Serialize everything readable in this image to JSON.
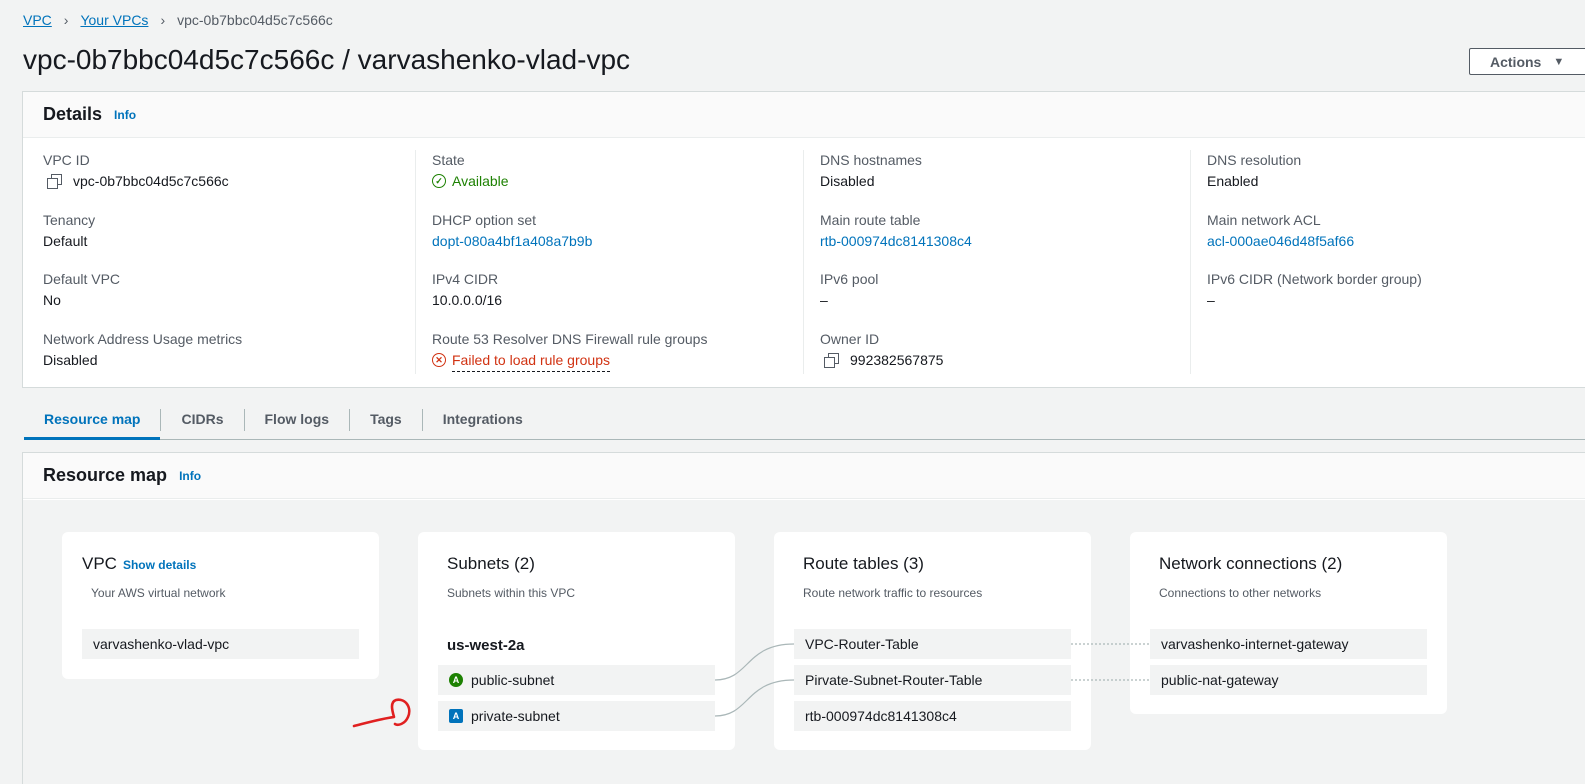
{
  "breadcrumb": {
    "root": "VPC",
    "parent": "Your VPCs",
    "current": "vpc-0b7bbc04d5c7c566c"
  },
  "page": {
    "title": "vpc-0b7bbc04d5c7c566c / varvashenko-vlad-vpc",
    "actions_label": "Actions"
  },
  "details": {
    "title": "Details",
    "info": "Info",
    "col1": [
      {
        "label": "VPC ID",
        "value": "vpc-0b7bbc04d5c7c566c"
      },
      {
        "label": "Tenancy",
        "value": "Default"
      },
      {
        "label": "Default VPC",
        "value": "No"
      },
      {
        "label": "Network Address Usage metrics",
        "value": "Disabled"
      }
    ],
    "col2": [
      {
        "label": "State",
        "value": "Available"
      },
      {
        "label": "DHCP option set",
        "value": "dopt-080a4bf1a408a7b9b"
      },
      {
        "label": "IPv4 CIDR",
        "value": "10.0.0.0/16"
      },
      {
        "label": "Route 53 Resolver DNS Firewall rule groups",
        "value": "Failed to load rule groups"
      }
    ],
    "col3": [
      {
        "label": "DNS hostnames",
        "value": "Disabled"
      },
      {
        "label": "Main route table",
        "value": "rtb-000974dc8141308c4"
      },
      {
        "label": "IPv6 pool",
        "value": "–"
      },
      {
        "label": "Owner ID",
        "value": "992382567875"
      }
    ],
    "col4": [
      {
        "label": "DNS resolution",
        "value": "Enabled"
      },
      {
        "label": "Main network ACL",
        "value": "acl-000ae046d48f5af66"
      },
      {
        "label": "IPv6 CIDR (Network border group)",
        "value": "–"
      }
    ]
  },
  "tabs": [
    "Resource map",
    "CIDRs",
    "Flow logs",
    "Tags",
    "Integrations"
  ],
  "resource_map": {
    "title": "Resource map",
    "info": "Info",
    "vpc_card": {
      "title": "VPC",
      "show_details": "Show details",
      "subtitle": "Your AWS virtual network",
      "item": "varvashenko-vlad-vpc"
    },
    "subnets_card": {
      "title": "Subnets (2)",
      "subtitle": "Subnets within this VPC",
      "az": "us-west-2a",
      "public_letter": "A",
      "private_letter": "A",
      "items": [
        "public-subnet",
        "private-subnet"
      ]
    },
    "routes_card": {
      "title": "Route tables (3)",
      "subtitle": "Route network traffic to resources",
      "items": [
        "VPC-Router-Table",
        "Pirvate-Subnet-Router-Table",
        "rtb-000974dc8141308c4"
      ]
    },
    "network_card": {
      "title": "Network connections (2)",
      "subtitle": "Connections to other networks",
      "items": [
        "varvashenko-internet-gateway",
        "public-nat-gateway"
      ]
    }
  },
  "colors": {
    "link": "#0073bb",
    "success": "#1d8102",
    "error": "#d13212",
    "annotation": "#e02020"
  }
}
